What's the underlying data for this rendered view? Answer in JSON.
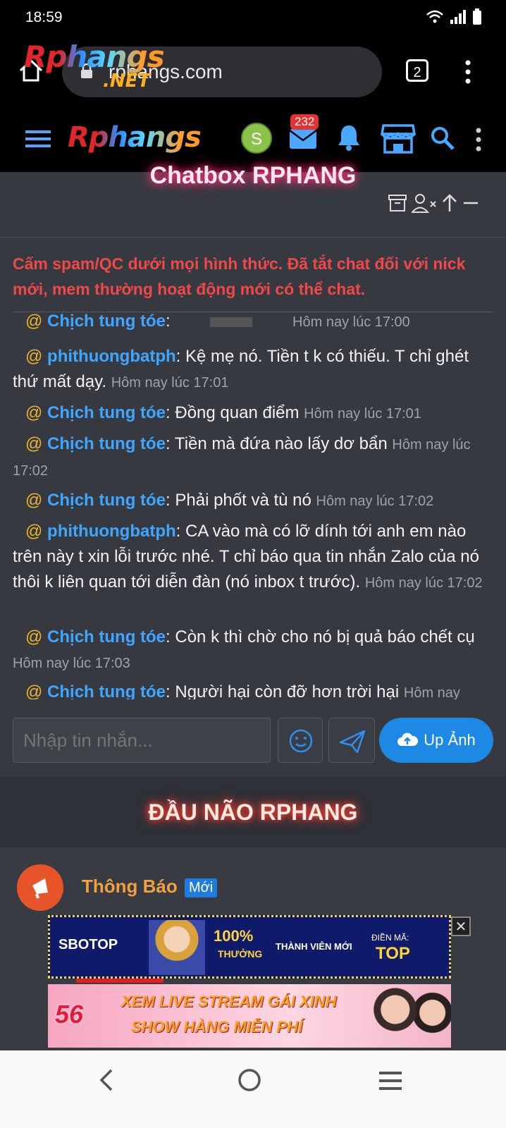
{
  "status_bar": {
    "time": "18:59"
  },
  "browser": {
    "url": "rphangs.com",
    "tab_count": "2",
    "logo_overlay_text": "Rphangs",
    "logo_overlay_sub": ".NET"
  },
  "site_header": {
    "logo": "Rphangs",
    "avatar_letter": "S",
    "mail_badge": "232"
  },
  "chatbox": {
    "title": "Chatbox RPHANG",
    "warning": "Cấm spam/QC dưới mọi hình thức. Đã tắt chat đối với nick mới, mem thường hoạt động mới có thể chat.",
    "messages": [
      {
        "at": "@",
        "user": "Chịch tung tóe",
        "text": ":",
        "time": "Hôm nay lúc 17:00"
      },
      {
        "at": "@",
        "user": "phithuongbatph",
        "text": ": Kệ mẹ nó. Tiền t k có thiếu. T chỉ ghét thứ mất dạy.",
        "time": "Hôm nay lúc 17:01"
      },
      {
        "at": "@",
        "user": "Chịch tung tóe",
        "text": ": Đồng quan điểm",
        "time": "Hôm nay lúc 17:01"
      },
      {
        "at": "@",
        "user": "Chịch tung tóe",
        "text": ": Tiền mà đứa nào lấy dơ bẩn",
        "time": "Hôm nay lúc 17:02"
      },
      {
        "at": "@",
        "user": "Chịch tung tóe",
        "text": ": Phải phốt và tù nó",
        "time": "Hôm nay lúc 17:02"
      },
      {
        "at": "@",
        "user": "phithuongbatph",
        "text": ": CA vào mà có lỡ dính tới anh em nào trên này t xin lỗi trước nhé. T chỉ báo qua tin nhắn Zalo của nó thôi k liên quan tới diễn đàn (nó inbox t trước).",
        "time": "Hôm nay lúc 17:02"
      },
      {
        "at": "@",
        "user": "Chịch tung tóe",
        "text": ": Còn k thì chờ cho nó bị quả báo chết cụ",
        "time": "Hôm nay lúc 17:03"
      },
      {
        "at": "@",
        "user": "Chịch tung tóe",
        "text": ": Người hại còn đỡ hơn trời hại",
        "time": "Hôm nay"
      }
    ],
    "input_placeholder": "Nhập tin nhắn...",
    "upload_label": "Up Ảnh"
  },
  "section": {
    "title": "ĐẦU NÃO RPHANG"
  },
  "forum": {
    "name": "Thông Báo",
    "badge": "Mới"
  },
  "ads": {
    "ad1": {
      "brand": "SBOTOP",
      "pct": "100%",
      "pct_sub": "THƯỞNG",
      "mid": "THÀNH VIÊN MỚI",
      "code_label": "ĐIỀN MÃ:",
      "code": "TOP",
      "close": "✕"
    },
    "ad2": {
      "brand": "56",
      "line1": "XEM LIVE STREAM GÁI XINH",
      "line2": "SHOW HÀNG MIỄN PHÍ"
    }
  },
  "colors": {
    "accent_blue": "#3fa6ff",
    "warning_red": "#f04848",
    "at_yellow": "#f0b429"
  }
}
